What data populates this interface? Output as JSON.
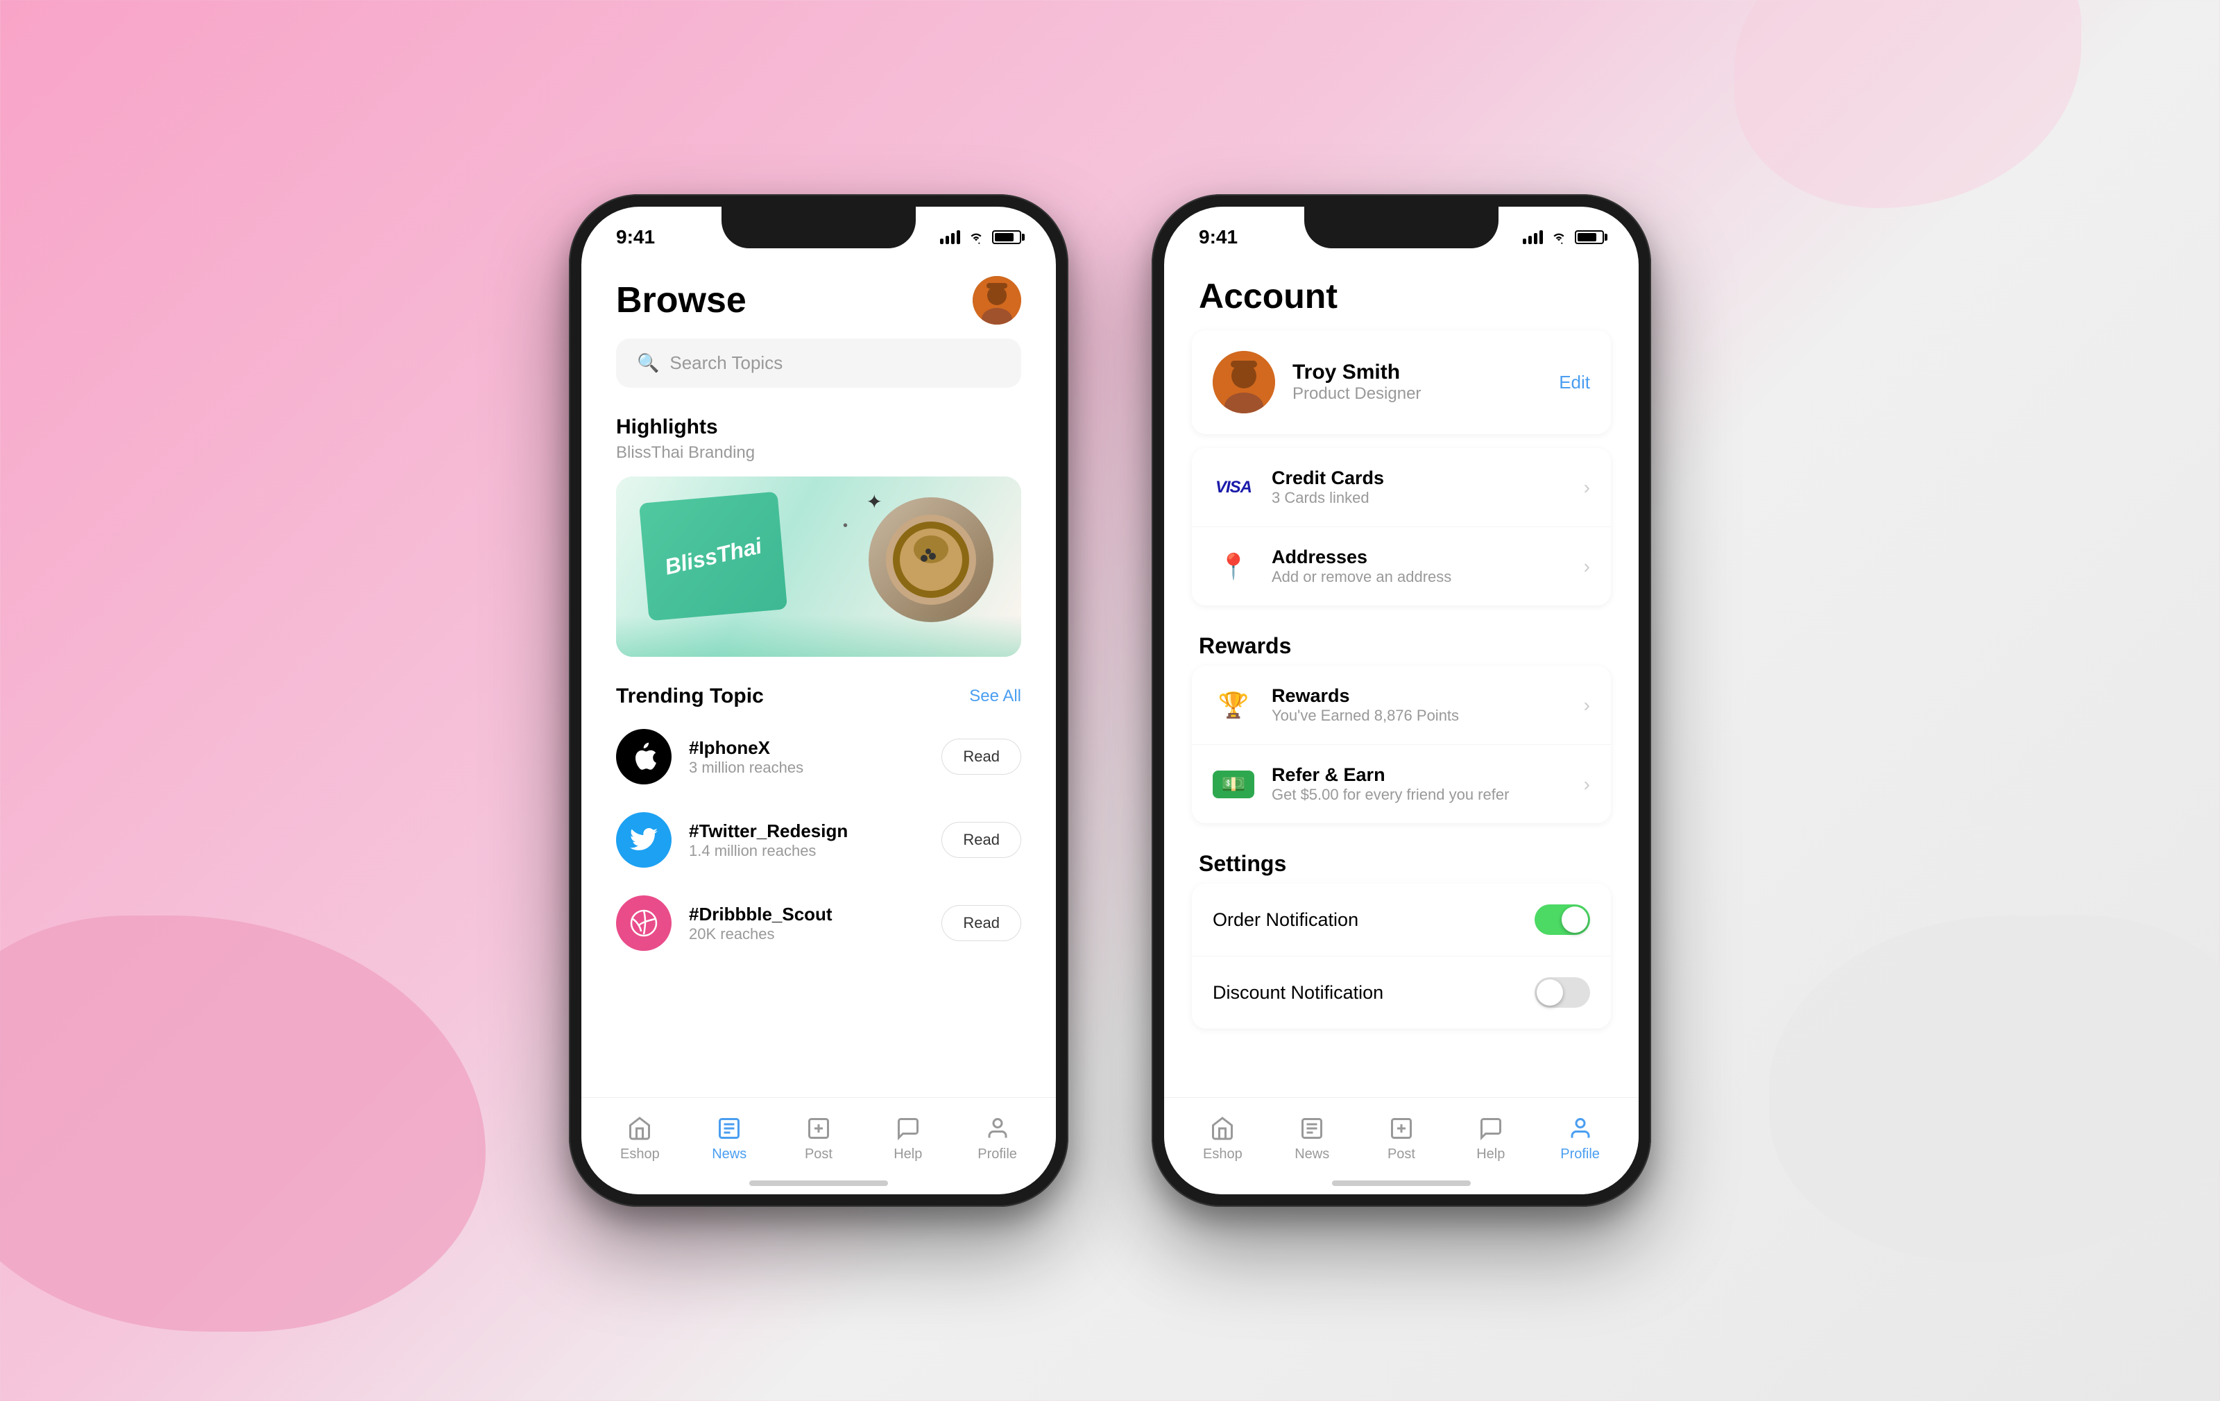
{
  "background": {
    "color_left": "#f8a4c8",
    "color_right": "#e8e8e8"
  },
  "phone1": {
    "status_bar": {
      "time": "9:41",
      "signal": "●●●●",
      "wifi": "WiFi",
      "battery": "80%"
    },
    "header": {
      "title": "Browse",
      "avatar_alt": "User avatar"
    },
    "search": {
      "placeholder": "Search Topics"
    },
    "highlights": {
      "section_label": "Highlights",
      "sub_label": "BlissThai Branding",
      "card_text": "BlissThai"
    },
    "trending": {
      "section_label": "Trending Topic",
      "see_all": "See All",
      "items": [
        {
          "icon": "apple",
          "name": "#IphoneX",
          "reaches": "3 million reaches",
          "read_label": "Read"
        },
        {
          "icon": "twitter",
          "name": "#Twitter_Redesign",
          "reaches": "1.4 million reaches",
          "read_label": "Read"
        },
        {
          "icon": "dribbble",
          "name": "#Dribbble_Scout",
          "reaches": "20K reaches",
          "read_label": "Read"
        }
      ]
    },
    "bottom_nav": {
      "items": [
        {
          "label": "Eshop",
          "icon": "🏠",
          "active": false
        },
        {
          "label": "News",
          "icon": "📰",
          "active": true
        },
        {
          "label": "Post",
          "icon": "📤",
          "active": false
        },
        {
          "label": "Help",
          "icon": "💬",
          "active": false
        },
        {
          "label": "Profile",
          "icon": "👤",
          "active": false
        }
      ]
    }
  },
  "phone2": {
    "status_bar": {
      "time": "9:41",
      "signal": "●●●●",
      "wifi": "WiFi",
      "battery": "80%"
    },
    "header": {
      "title": "Account"
    },
    "profile": {
      "name": "Troy Smith",
      "role": "Product Designer",
      "edit_label": "Edit"
    },
    "credit_cards": {
      "title": "Credit Cards",
      "subtitle": "3 Cards linked",
      "visa_text": "VISA"
    },
    "addresses": {
      "title": "Addresses",
      "subtitle": "Add or remove an address"
    },
    "rewards_section_label": "Rewards",
    "rewards": {
      "title": "Rewards",
      "subtitle": "You've Earned 8,876 Points"
    },
    "refer": {
      "title": "Refer & Earn",
      "subtitle": "Get $5.00 for every friend you refer"
    },
    "settings_section_label": "Settings",
    "order_notification": {
      "label": "Order Notification",
      "enabled": true
    },
    "discount_notification": {
      "label": "Discount Notification",
      "enabled": false
    },
    "bottom_nav": {
      "items": [
        {
          "label": "Eshop",
          "icon": "🏠",
          "active": false
        },
        {
          "label": "News",
          "icon": "📰",
          "active": false
        },
        {
          "label": "Post",
          "icon": "📤",
          "active": false
        },
        {
          "label": "Help",
          "icon": "💬",
          "active": false
        },
        {
          "label": "Profile",
          "icon": "👤",
          "active": true
        }
      ]
    }
  }
}
